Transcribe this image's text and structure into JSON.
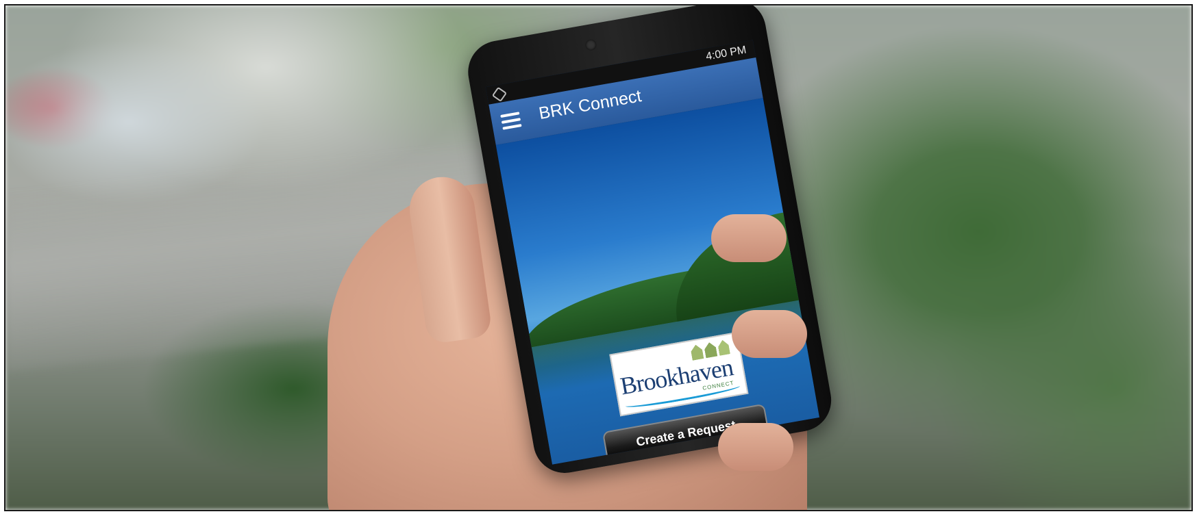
{
  "status_bar": {
    "time": "4:00 PM"
  },
  "app_bar": {
    "title": "BRK Connect",
    "menu_icon": "hamburger-menu-icon"
  },
  "logo": {
    "wordmark": "Brookhaven",
    "tagline": "CONNECT"
  },
  "actions": {
    "create_request_label": "Create a Request"
  },
  "colors": {
    "app_bar": "#2a5a9c",
    "button": "#1b1b1b",
    "logo_text": "#1c3f73"
  }
}
